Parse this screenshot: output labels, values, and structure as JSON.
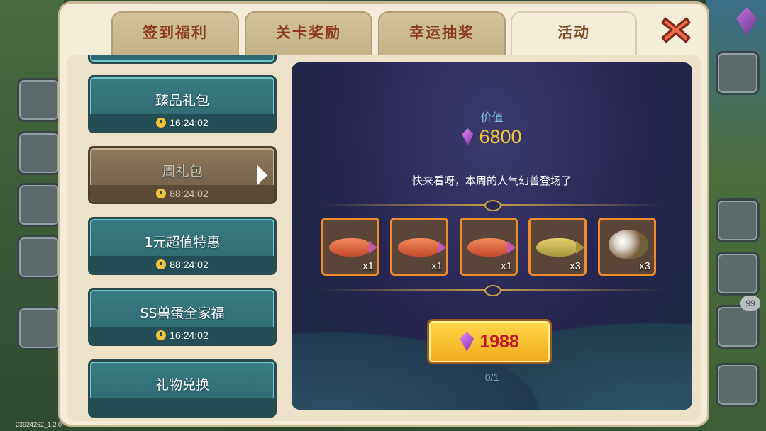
{
  "tabs": [
    {
      "label": "签到福利",
      "active": false
    },
    {
      "label": "关卡奖励",
      "active": false
    },
    {
      "label": "幸运抽奖",
      "active": false
    },
    {
      "label": "活动",
      "active": true
    }
  ],
  "close_icon": "close-icon",
  "packs": [
    {
      "name": "臻品礼包",
      "timer": "16:24:02",
      "selected": false
    },
    {
      "name": "周礼包",
      "timer": "88:24:02",
      "selected": true
    },
    {
      "name": "1元超值特惠",
      "timer": "88:24:02",
      "selected": false
    },
    {
      "name": "SS兽蛋全家福",
      "timer": "16:24:02",
      "selected": false
    },
    {
      "name": "礼物兑换",
      "timer": "",
      "selected": false
    }
  ],
  "detail": {
    "value_label": "价值",
    "value_amount": "6800",
    "description": "快来看呀，本周的人气幻兽登场了",
    "rewards": [
      {
        "icon": "red-fish-icon",
        "qty": "x1"
      },
      {
        "icon": "red-fish-icon",
        "qty": "x1"
      },
      {
        "icon": "red-fish-icon",
        "qty": "x1"
      },
      {
        "icon": "yellow-fish-icon",
        "qty": "x3"
      },
      {
        "icon": "egg-nest-icon",
        "qty": "x3"
      }
    ],
    "buy_price": "1988",
    "purchase_progress": "0/1"
  },
  "side": {
    "notification_count": "99"
  },
  "version": "23924262_1.2.0",
  "colors": {
    "accent_orange": "#f08d2a",
    "price_red": "#c0162d",
    "gold": "#f2c637",
    "teal": "#2d6770"
  }
}
